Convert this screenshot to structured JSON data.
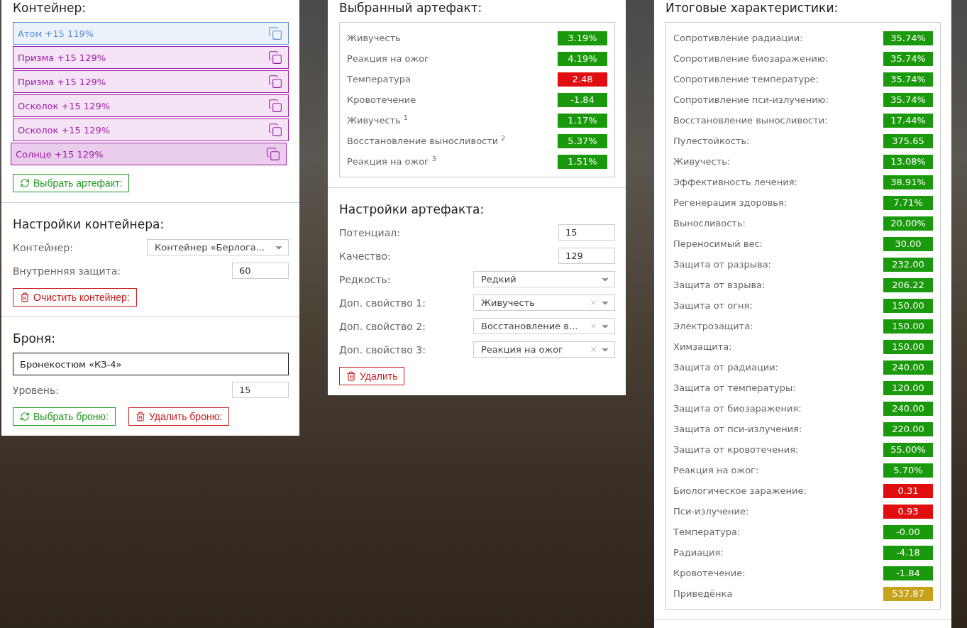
{
  "container_panel": {
    "title": "Контейнер:",
    "artifacts": [
      {
        "label": "Атом +15 119%",
        "color": "#5b8fd0",
        "selected": false
      },
      {
        "label": "Призма +15 129%",
        "color": "#a01ca8",
        "selected": false
      },
      {
        "label": "Призма +15 129%",
        "color": "#a01ca8",
        "selected": false
      },
      {
        "label": "Осколок +15 129%",
        "color": "#a01ca8",
        "selected": false
      },
      {
        "label": "Осколок +15 129%",
        "color": "#a01ca8",
        "selected": false
      },
      {
        "label": "Солнце +15 129%",
        "color": "#a01ca8",
        "selected": true
      }
    ],
    "buttons": [
      {
        "kind": "refresh",
        "label": "Выбрать артефакт:"
      }
    ]
  },
  "container_settings": {
    "title": "Настройки контейнера:",
    "fields": [
      {
        "kind": "select",
        "label": "Контейнер:",
        "value": "Контейнер «Берлога...",
        "clearable": false
      },
      {
        "kind": "input",
        "label": "Внутренняя защита:",
        "value": "60"
      }
    ],
    "buttons": [
      {
        "kind": "delete",
        "label": "Очистить контейнер:"
      }
    ]
  },
  "armor": {
    "title": "Броня:",
    "name": "Бронекостюм «КЗ-4»",
    "fields": [
      {
        "kind": "input",
        "label": "Уровень:",
        "value": "15"
      }
    ],
    "buttons": [
      {
        "kind": "refresh",
        "label": "Выбрать броню:"
      },
      {
        "kind": "delete",
        "label": "Удалить броню:"
      }
    ]
  },
  "selected_artifact": {
    "title": "Выбранный артефакт:",
    "stats": [
      {
        "label": "Живучесть",
        "value": "3.19%",
        "color": "#1a990c"
      },
      {
        "label": "Реакция на ожог",
        "value": "4.19%",
        "color": "#1a990c"
      },
      {
        "label": "Температура",
        "value": "2.48",
        "color": "#e00e0e"
      },
      {
        "label": "Кровотечение",
        "value": "-1.84",
        "color": "#1a990c"
      },
      {
        "label": "Живучесть $^{1}$",
        "value": "1.17%",
        "color": "#1a990c"
      },
      {
        "label": "Восстановление выносливости $^{2}$",
        "value": "5.37%",
        "color": "#1a990c"
      },
      {
        "label": "Реакция на ожог $^{3}$",
        "value": "1.51%",
        "color": "#1a990c"
      }
    ]
  },
  "artifact_settings": {
    "title": "Настройки артефакта:",
    "fields": [
      {
        "kind": "input",
        "label": "Потенциал:",
        "value": "15"
      },
      {
        "kind": "input",
        "label": "Качество:",
        "value": "129"
      },
      {
        "kind": "select",
        "label": "Редкость:",
        "value": "Редкий",
        "clearable": false
      },
      {
        "kind": "select",
        "label": "Доп. свойство 1:",
        "value": "Живучесть",
        "clearable": true
      },
      {
        "kind": "select",
        "label": "Доп. свойство 2:",
        "value": "Восстановление в...",
        "clearable": true
      },
      {
        "kind": "select",
        "label": "Доп. свойство 3:",
        "value": "Реакция на ожог",
        "clearable": true
      }
    ],
    "buttons": [
      {
        "kind": "delete",
        "label": "Удалить"
      }
    ]
  },
  "totals": {
    "title": "Итоговые характеристики:",
    "stats": [
      {
        "label": "Сопротивление радиации:",
        "value": "35.74%",
        "color": "#1a990c"
      },
      {
        "label": "Сопротивление биозаражению:",
        "value": "35.74%",
        "color": "#1a990c"
      },
      {
        "label": "Сопротивление температуре:",
        "value": "35.74%",
        "color": "#1a990c"
      },
      {
        "label": "Сопротивление пси-излучению:",
        "value": "35.74%",
        "color": "#1a990c"
      },
      {
        "label": "Восстановление выносливости:",
        "value": "17.44%",
        "color": "#1a990c"
      },
      {
        "label": "Пулестойкость:",
        "value": "375.65",
        "color": "#1a990c"
      },
      {
        "label": "Живучесть:",
        "value": "13.08%",
        "color": "#1a990c"
      },
      {
        "label": "Эффективность лечения:",
        "value": "38.91%",
        "color": "#1a990c"
      },
      {
        "label": "Регенерация здоровья:",
        "value": "7.71%",
        "color": "#1a990c"
      },
      {
        "label": "Выносливость:",
        "value": "20.00%",
        "color": "#1a990c"
      },
      {
        "label": "Переносимый вес:",
        "value": "30.00",
        "color": "#1a990c"
      },
      {
        "label": "Защита от разрыва:",
        "value": "232.00",
        "color": "#1a990c"
      },
      {
        "label": "Защита от взрыва:",
        "value": "206.22",
        "color": "#1a990c"
      },
      {
        "label": "Защита от огня:",
        "value": "150.00",
        "color": "#1a990c"
      },
      {
        "label": "Электрозащита:",
        "value": "150.00",
        "color": "#1a990c"
      },
      {
        "label": "Химзащита:",
        "value": "150.00",
        "color": "#1a990c"
      },
      {
        "label": "Защита от радиации:",
        "value": "240.00",
        "color": "#1a990c"
      },
      {
        "label": "Защита от температуры:",
        "value": "120.00",
        "color": "#1a990c"
      },
      {
        "label": "Защита от биозаражения:",
        "value": "240.00",
        "color": "#1a990c"
      },
      {
        "label": "Защита от пси-излучения:",
        "value": "220.00",
        "color": "#1a990c"
      },
      {
        "label": "Защита от кровотечения:",
        "value": "55.00%",
        "color": "#1a990c"
      },
      {
        "label": "Реакция на ожог:",
        "value": "5.70%",
        "color": "#1a990c"
      },
      {
        "label": "Биологическое заражение:",
        "value": "0.31",
        "color": "#e00e0e"
      },
      {
        "label": "Пси-излучение:",
        "value": "0.93",
        "color": "#e00e0e"
      },
      {
        "label": "Температура:",
        "value": "-0.00",
        "color": "#1a990c"
      },
      {
        "label": "Радиация:",
        "value": "-4.18",
        "color": "#1a990c"
      },
      {
        "label": "Кровотечение:",
        "value": "-1.84",
        "color": "#1a990c"
      },
      {
        "label": "Приведёнка",
        "value": "537.87",
        "color": "#c9a21c"
      }
    ]
  }
}
